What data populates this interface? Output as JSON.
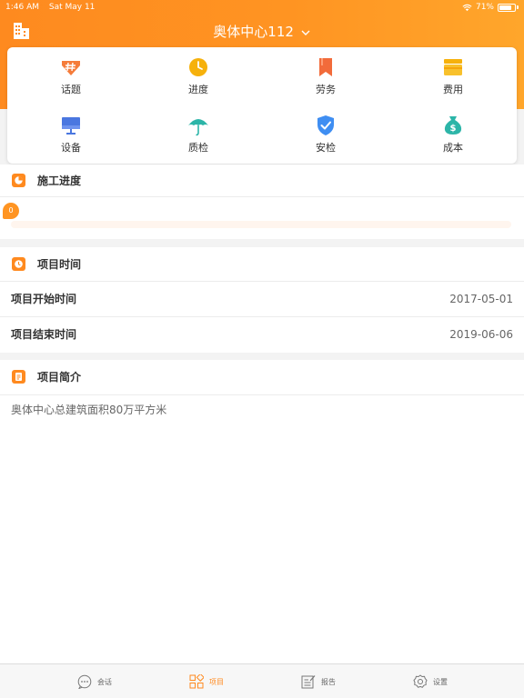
{
  "status_bar": {
    "time": "1:46 AM",
    "date": "Sat May 11",
    "battery": "71%"
  },
  "nav": {
    "title": "奥体中心112"
  },
  "menu": {
    "items": [
      {
        "label": "话题",
        "icon": "hashtag-icon"
      },
      {
        "label": "进度",
        "icon": "clock-icon"
      },
      {
        "label": "劳务",
        "icon": "bookmark-icon"
      },
      {
        "label": "费用",
        "icon": "wallet-icon"
      },
      {
        "label": "设备",
        "icon": "monitor-icon"
      },
      {
        "label": "质检",
        "icon": "umbrella-icon"
      },
      {
        "label": "安检",
        "icon": "shield-icon"
      },
      {
        "label": "成本",
        "icon": "money-bag-icon"
      }
    ]
  },
  "progress": {
    "title": "施工进度",
    "value": 0,
    "bubble": "0"
  },
  "project_time": {
    "title": "项目时间",
    "rows": [
      {
        "label": "项目开始时间",
        "value": "2017-05-01"
      },
      {
        "label": "项目结束时间",
        "value": "2019-06-06"
      }
    ]
  },
  "summary": {
    "title": "项目简介",
    "text": "奥体中心总建筑面积80万平方米"
  },
  "tabbar": {
    "items": [
      {
        "label": "会话",
        "icon": "chat-icon"
      },
      {
        "label": "项目",
        "icon": "grid-icon",
        "active": true
      },
      {
        "label": "报告",
        "icon": "report-icon"
      },
      {
        "label": "设置",
        "icon": "settings-icon"
      }
    ]
  },
  "colors": {
    "accent": "#ff8a1f",
    "header_start": "#fe8a1f",
    "header_end": "#ffa62b"
  }
}
